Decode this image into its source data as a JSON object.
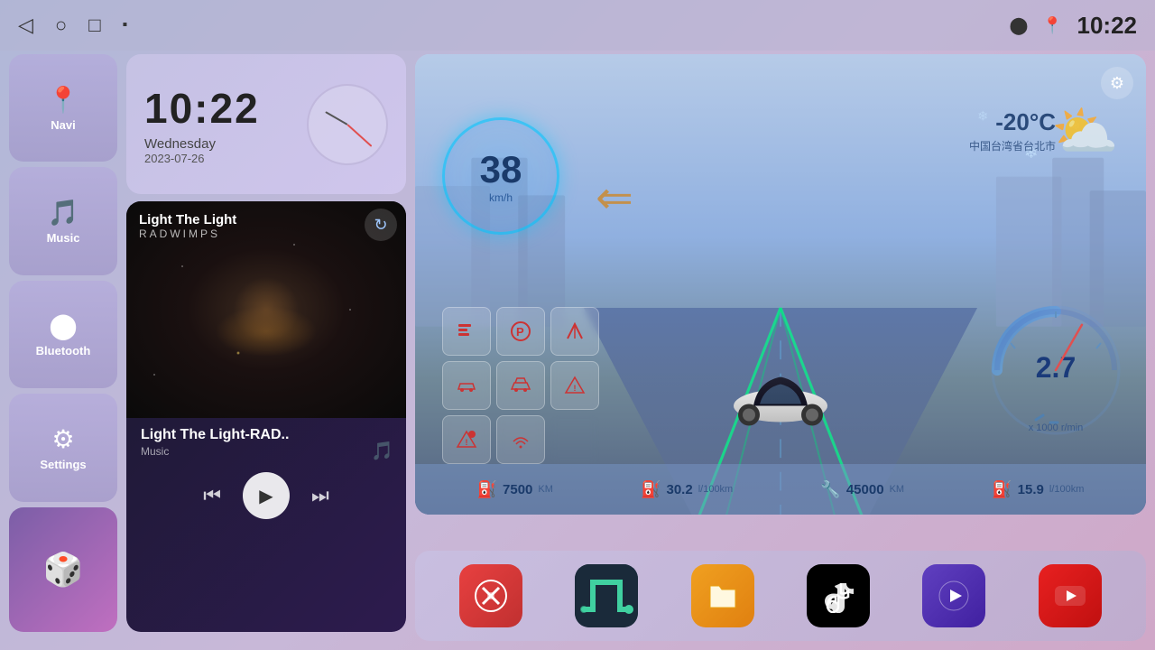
{
  "topbar": {
    "time": "10:22",
    "back_label": "◁",
    "home_label": "○",
    "recents_label": "□",
    "screenshot_label": "⬛"
  },
  "sidebar": {
    "items": [
      {
        "id": "navi",
        "label": "Navi",
        "icon": "📍"
      },
      {
        "id": "music",
        "label": "Music",
        "icon": "🎵"
      },
      {
        "id": "bluetooth",
        "label": "Bluetooth",
        "icon": "⬤"
      },
      {
        "id": "settings",
        "label": "Settings",
        "icon": "⬡"
      }
    ],
    "app3d_label": ""
  },
  "clock": {
    "time": "10:22",
    "day": "Wednesday",
    "date": "2023-07-26"
  },
  "music": {
    "track_name": "Light The Light",
    "artist": "RADWIMPS",
    "song_title": "Light The Light-RAD..",
    "song_type": "Music"
  },
  "controls": {
    "prev": "⏮",
    "play": "▶",
    "next": "⏭"
  },
  "display": {
    "speed": "38",
    "speed_unit": "km/h",
    "temperature": "-20",
    "temp_unit": "°C",
    "location": "中国台湾省台北市",
    "rpm_value": "2.7",
    "rpm_unit": "x 1000 r/min",
    "settings_icon": "⚙"
  },
  "stats": [
    {
      "icon": "⛽",
      "value": "7500",
      "unit": "KM"
    },
    {
      "icon": "⛽",
      "value": "30.2",
      "unit": "l/100km"
    },
    {
      "icon": "🔧",
      "value": "45000",
      "unit": "KM"
    },
    {
      "icon": "⛽",
      "value": "15.9",
      "unit": "l/100km"
    }
  ],
  "apps": [
    {
      "id": "tools",
      "label": "🔧",
      "class": "app-icon-tools"
    },
    {
      "id": "snake",
      "label": "🐍",
      "class": "app-icon-snake"
    },
    {
      "id": "files",
      "label": "📁",
      "class": "app-icon-files"
    },
    {
      "id": "tiktok",
      "label": "🎵",
      "class": "app-icon-tiktok"
    },
    {
      "id": "player",
      "label": "▶",
      "class": "app-icon-player"
    },
    {
      "id": "youtube",
      "label": "▶",
      "class": "app-icon-youtube"
    }
  ],
  "grid_buttons": [
    "💡",
    "🅿",
    "🛣",
    "🚗",
    "🚘",
    "⚠",
    "⚠",
    "📡",
    ""
  ]
}
